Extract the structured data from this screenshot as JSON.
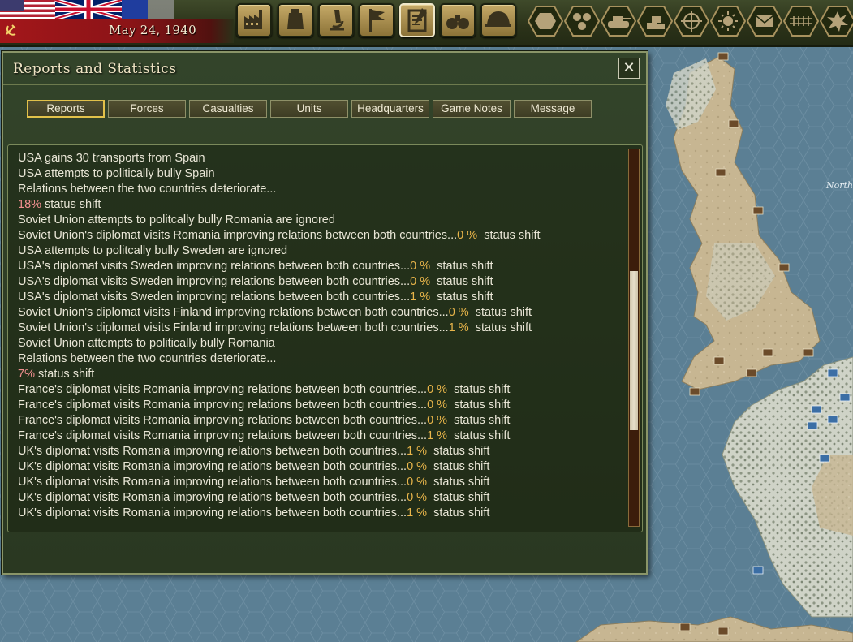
{
  "top_bar": {
    "date": "May 24, 1940",
    "buttons": [
      {
        "name": "production-button",
        "icon": "factory-icon"
      },
      {
        "name": "naval-button",
        "icon": "ship-icon"
      },
      {
        "name": "research-button",
        "icon": "microscope-icon"
      },
      {
        "name": "diplomacy-button",
        "icon": "flag-icon"
      },
      {
        "name": "reports-button",
        "icon": "clipboard-icon",
        "active": true
      },
      {
        "name": "intelligence-button",
        "icon": "binoculars-icon"
      },
      {
        "name": "military-button",
        "icon": "helmet-icon"
      },
      {
        "name": "hex-button",
        "icon": "hexagon-icon"
      },
      {
        "name": "supply-button",
        "icon": "hex-cluster-icon"
      },
      {
        "name": "unit-button",
        "icon": "tank-icon"
      },
      {
        "name": "economy-button",
        "icon": "coins-icon"
      },
      {
        "name": "target-button",
        "icon": "crosshair-icon"
      },
      {
        "name": "weather-button",
        "icon": "sun-icon"
      },
      {
        "name": "mail-button",
        "icon": "envelope-icon"
      },
      {
        "name": "rail-button",
        "icon": "railway-icon"
      },
      {
        "name": "combat-button",
        "icon": "explosion-icon"
      }
    ]
  },
  "dialog": {
    "title": "Reports and Statistics",
    "close_icon": "close-icon",
    "tabs": [
      {
        "label": "Reports",
        "active": true
      },
      {
        "label": "Forces"
      },
      {
        "label": "Casualties"
      },
      {
        "label": "Units"
      },
      {
        "label": "Headquarters"
      },
      {
        "label": "Game Notes"
      },
      {
        "label": "Message"
      }
    ],
    "scroll_position": 0.57,
    "log": [
      {
        "text": "USA gains 30 transports from Spain"
      },
      {
        "text": "USA attempts to politically bully Spain"
      },
      {
        "text": "Relations between the two countries deteriorate..."
      },
      {
        "pct": "18%",
        "pct_color": "neg",
        "text": " status shift"
      },
      {
        "text": "Soviet Union attempts to politcally bully Romania are ignored"
      },
      {
        "text": "Soviet Union's diplomat visits Romania improving relations between both countries...",
        "pct": "0 %",
        "after": "  status shift"
      },
      {
        "text": "USA attempts to politcally bully Sweden are ignored"
      },
      {
        "text": "USA's diplomat visits Sweden improving relations between both countries...",
        "pct": "0 %",
        "after": "  status shift"
      },
      {
        "text": "USA's diplomat visits Sweden improving relations between both countries...",
        "pct": "0 %",
        "after": "  status shift"
      },
      {
        "text": "USA's diplomat visits Sweden improving relations between both countries...",
        "pct": "1 %",
        "after": "  status shift"
      },
      {
        "text": "Soviet Union's diplomat visits Finland improving relations between both countries...",
        "pct": "0 %",
        "after": "  status shift"
      },
      {
        "text": "Soviet Union's diplomat visits Finland improving relations between both countries...",
        "pct": "1 %",
        "after": "  status shift"
      },
      {
        "text": "Soviet Union attempts to politically bully Romania"
      },
      {
        "text": "Relations between the two countries deteriorate..."
      },
      {
        "pct": "7%",
        "pct_color": "neg",
        "text": " status shift"
      },
      {
        "text": "France's diplomat visits Romania improving relations between both countries...",
        "pct": "0 %",
        "after": "  status shift"
      },
      {
        "text": "France's diplomat visits Romania improving relations between both countries...",
        "pct": "0 %",
        "after": "  status shift"
      },
      {
        "text": "France's diplomat visits Romania improving relations between both countries...",
        "pct": "0 %",
        "after": "  status shift"
      },
      {
        "text": "France's diplomat visits Romania improving relations between both countries...",
        "pct": "1 %",
        "after": "  status shift"
      },
      {
        "text": "UK's diplomat visits Romania improving relations between both countries...",
        "pct": "1 %",
        "after": "  status shift"
      },
      {
        "text": "UK's diplomat visits Romania improving relations between both countries...",
        "pct": "0 %",
        "after": "  status shift"
      },
      {
        "text": "UK's diplomat visits Romania improving relations between both countries...",
        "pct": "0 %",
        "after": "  status shift"
      },
      {
        "text": "UK's diplomat visits Romania improving relations between both countries...",
        "pct": "0 %",
        "after": "  status shift"
      },
      {
        "text": "UK's diplomat visits Romania improving relations between both countries...",
        "pct": "1 %",
        "after": "  status shift"
      }
    ]
  },
  "map": {
    "labels": [
      "North"
    ]
  },
  "colors": {
    "sea": "#5b7f94",
    "land": "#c7b692",
    "dialog_bg": "#2f3f26",
    "pct_text": "#e8b54a",
    "neg_text": "#f08f8f",
    "tab_active_border": "#e2c14a"
  }
}
